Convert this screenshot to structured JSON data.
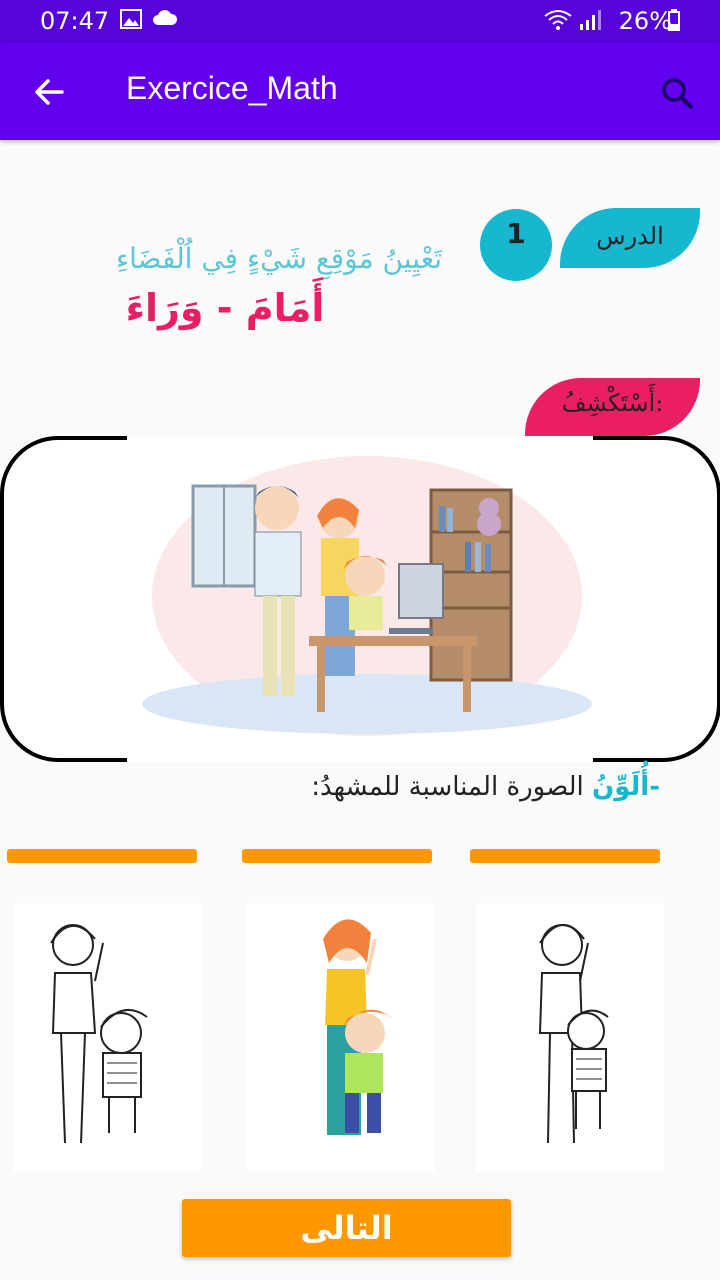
{
  "status_bar": {
    "time": "07:47",
    "battery": "26%"
  },
  "app_bar": {
    "title": "Exercice_Math"
  },
  "lesson": {
    "tag_label": "الدرس",
    "number": "1",
    "subtitle": "تَعْيِينُ مَوْقِعِ شَيْءٍ فِي اُلْفَضَاءِ",
    "title": "أَمَامَ - وَرَاءَ"
  },
  "discover": {
    "label": "أَسْتَكْشِفُ:"
  },
  "instruction": {
    "highlight": "-أُلَوِّنُ",
    "text": " الصورة المناسبة للمشهدُ:"
  },
  "choices": [
    {
      "id": "choice-left",
      "colored": false
    },
    {
      "id": "choice-middle",
      "colored": true
    },
    {
      "id": "choice-right",
      "colored": false
    }
  ],
  "colors": {
    "accent": "#6200ee",
    "status": "#5505d8",
    "cyan": "#17b7cf",
    "pink": "#e91e63",
    "orange": "#ff9800"
  },
  "buttons": {
    "next_label": "التالى"
  }
}
